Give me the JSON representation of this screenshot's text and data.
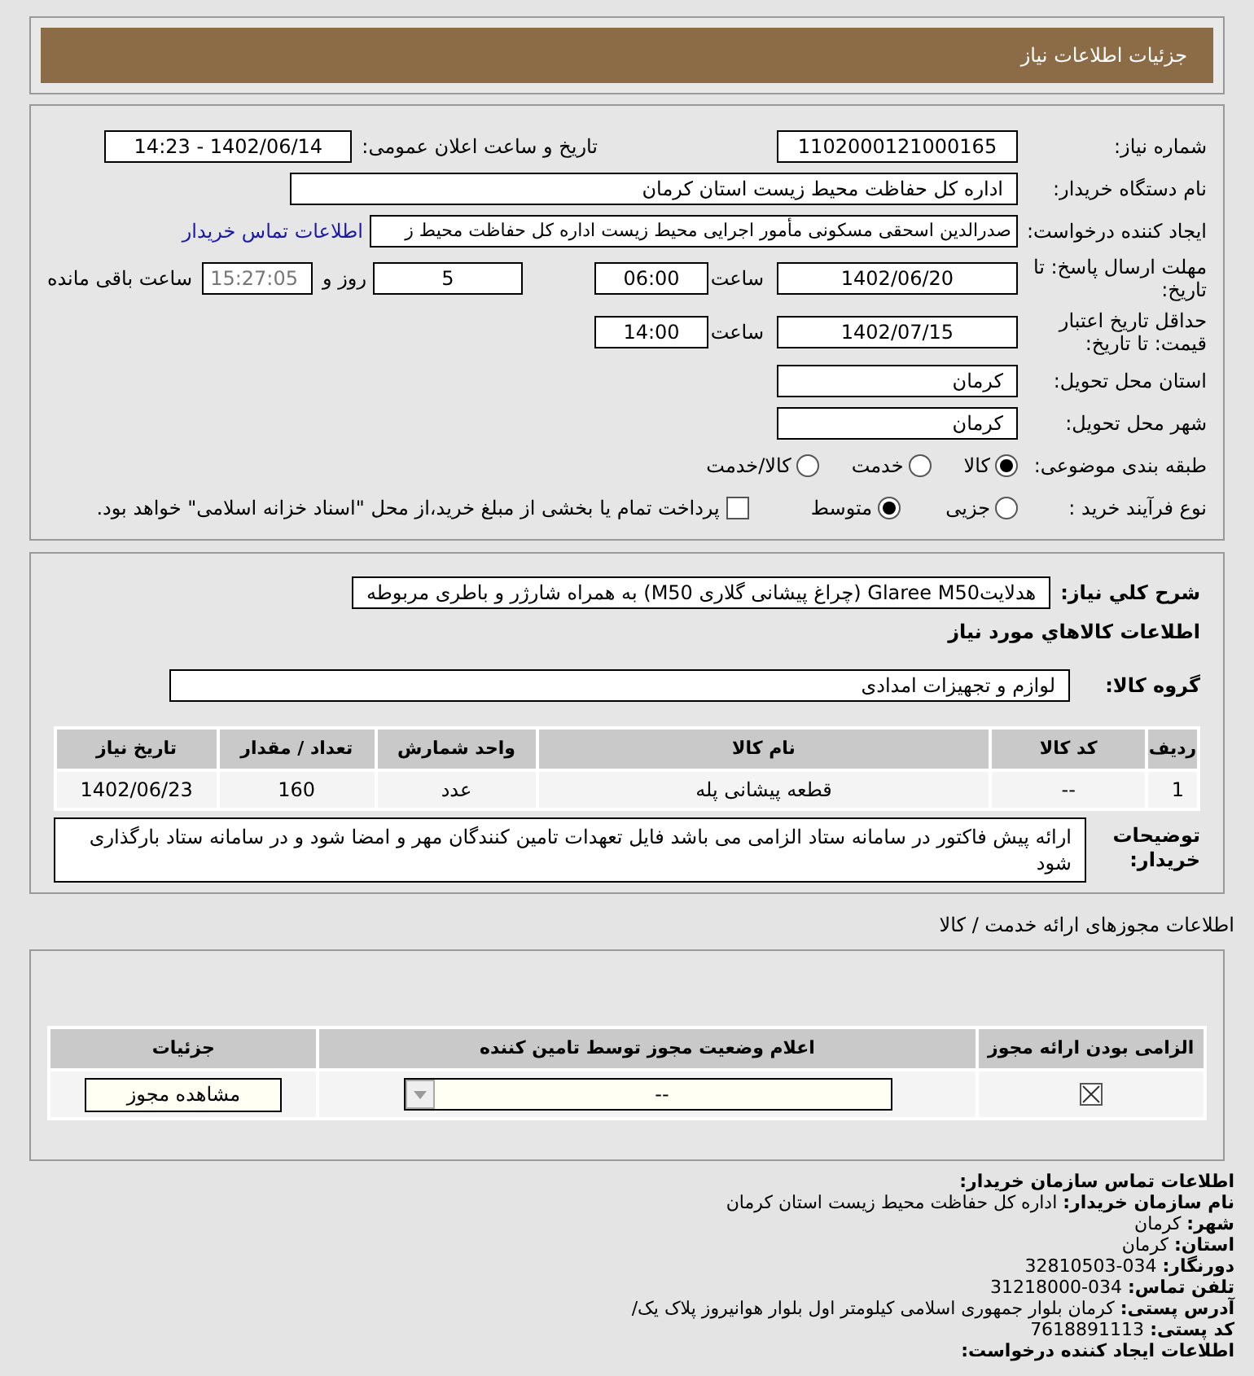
{
  "header": {
    "title": "جزئیات اطلاعات نیاز"
  },
  "need_form": {
    "need_number": {
      "label": "شماره نیاز:",
      "value": "1102000121000165"
    },
    "announce": {
      "label": "تاریخ و ساعت اعلان عمومی:",
      "value": "1402/06/14 - 14:23"
    },
    "buyer": {
      "label": "نام دستگاه خریدار:",
      "value": "اداره کل حفاظت محیط زیست استان کرمان"
    },
    "requester": {
      "label": "ایجاد کننده درخواست:",
      "value": "صدرالدین اسحقی مسکونی مأمور اجرایی محیط زیست اداره کل حفاظت محیط ز",
      "link": "اطلاعات تماس خریدار"
    },
    "deadline": {
      "label": "مهلت ارسال پاسخ: تا تاریخ:",
      "date": "1402/06/20",
      "time_label": "ساعت",
      "time": "06:00",
      "days": "5",
      "days_label": "روز و",
      "remaining": "15:27:05",
      "remaining_label": "ساعت باقی مانده"
    },
    "validity": {
      "label": "حداقل تاریخ اعتبار قیمت: تا تاریخ:",
      "date": "1402/07/15",
      "time_label": "ساعت",
      "time": "14:00"
    },
    "province": {
      "label": "استان محل تحویل:",
      "value": "کرمان"
    },
    "city": {
      "label": "شهر محل تحویل:",
      "value": "کرمان"
    },
    "category": {
      "label": "طبقه بندی موضوعی:",
      "options": [
        {
          "label": "کالا",
          "selected": true
        },
        {
          "label": "خدمت",
          "selected": false
        },
        {
          "label": "کالا/خدمت",
          "selected": false
        }
      ]
    },
    "process": {
      "label": "نوع فرآیند خرید :",
      "options": [
        {
          "label": "جزیی",
          "selected": false
        },
        {
          "label": "متوسط",
          "selected": true
        }
      ],
      "payment": {
        "label": "پرداخت تمام یا بخشی از مبلغ خرید،از محل \"اسناد خزانه اسلامی\" خواهد بود.",
        "checked": false
      }
    }
  },
  "goods": {
    "summary": {
      "label": "شرح کلي نیاز:",
      "value": "هدلایتGlaree M50 (چراغ پیشانی گلاری M50) به همراه شارژر و باطری مربوطه"
    },
    "title": "اطلاعات کالاهاي مورد نیاز",
    "group": {
      "label": "گروه کالا:",
      "value": "لوازم و تجهیزات امدادی"
    },
    "table": {
      "columns": [
        "ردیف",
        "کد کالا",
        "نام کالا",
        "واحد شمارش",
        "تعداد / مقدار",
        "تاریخ نیاز"
      ],
      "rows": [
        [
          "1",
          "--",
          "قطعه پیشانی پله",
          "عدد",
          "160",
          "1402/06/23"
        ]
      ]
    },
    "notes": {
      "label": "توضیحات خریدار:",
      "value": "ارائه پیش فاکتور در سامانه ستاد الزامی می باشد فایل تعهدات تامین کنندگان مهر و امضا شود و در سامانه ستاد بارگذاری شود"
    }
  },
  "permits": {
    "title": "اطلاعات مجوزهای ارائه خدمت / کالا",
    "columns": [
      "الزامی بودن ارائه مجوز",
      "اعلام وضعیت مجوز توسط تامین کننده",
      "جزئیات"
    ],
    "rows": [
      {
        "required": true,
        "status": "--",
        "button": "مشاهده مجوز"
      }
    ]
  },
  "contact": {
    "title": "اطلاعات تماس سازمان خریدار:",
    "lines": [
      {
        "label": "نام سازمان خریدار:",
        "value": "اداره کل حفاظت محیط زیست استان کرمان"
      },
      {
        "label": "شهر:",
        "value": "کرمان"
      },
      {
        "label": "استان:",
        "value": "کرمان"
      },
      {
        "label": "دورنگار:",
        "value": "034-32810503"
      },
      {
        "label": "تلفن تماس:",
        "value": "034-31218000"
      },
      {
        "label": "آدرس پستی:",
        "value": "کرمان بلوار جمهوری اسلامی کیلومتر اول بلوار هوانیروز پلاک یک/"
      },
      {
        "label": "کد پستی:",
        "value": "7618891113"
      }
    ],
    "next_title": "اطلاعات ایجاد کننده درخواست:"
  }
}
